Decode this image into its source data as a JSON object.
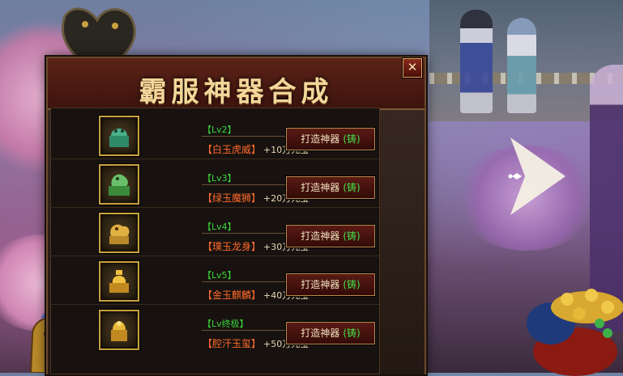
{
  "title": "霸服神器合成",
  "close_glyph": "✕",
  "items": [
    {
      "level": "【Lv2】",
      "name": "【白玉虎威】",
      "price": "+10万元宝",
      "button": "打造神器",
      "button_suffix": "(铸)",
      "icon": "jade-tiger-seal-icon"
    },
    {
      "level": "【Lv3】",
      "name": "【绿玉魔狮】",
      "price": "+20万元宝",
      "button": "打造神器",
      "button_suffix": "(铸)",
      "icon": "green-lion-seal-icon"
    },
    {
      "level": "【Lv4】",
      "name": "【璞玉龙身】",
      "price": "+30万元宝",
      "button": "打造神器",
      "button_suffix": "(铸)",
      "icon": "dragon-seal-icon"
    },
    {
      "level": "【Lv5】",
      "name": "【金玉麒麟】",
      "price": "+40万元宝",
      "button": "打造神器",
      "button_suffix": "(铸)",
      "icon": "golden-qilin-seal-icon"
    },
    {
      "level": "【Lv终极】",
      "name": "【腔汗玉玺】",
      "price": "+50万元宝",
      "button": "打造神器",
      "button_suffix": "(铸)",
      "icon": "imperial-seal-icon"
    }
  ],
  "colors": {
    "level": "#3bd43b",
    "name": "#ff6a2a",
    "title": "#f2d89a",
    "frame": "#c9a13e"
  }
}
